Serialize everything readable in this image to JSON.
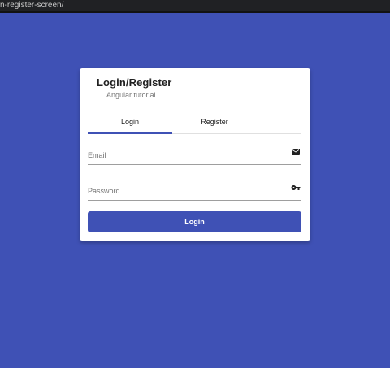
{
  "browser": {
    "url_fragment": "n-register-screen/"
  },
  "card": {
    "title": "Login/Register",
    "subtitle": "Angular tutorial"
  },
  "tabs": [
    {
      "label": "Login",
      "active": true
    },
    {
      "label": "Register",
      "active": false
    }
  ],
  "form": {
    "email": {
      "placeholder": "Email",
      "value": "",
      "icon": "mail-icon"
    },
    "password": {
      "placeholder": "Password",
      "value": "",
      "icon": "key-icon"
    },
    "submit_label": "Login"
  },
  "colors": {
    "primary": "#3f51b5",
    "card_background": "#ffffff",
    "browser_bar": "#202124"
  }
}
